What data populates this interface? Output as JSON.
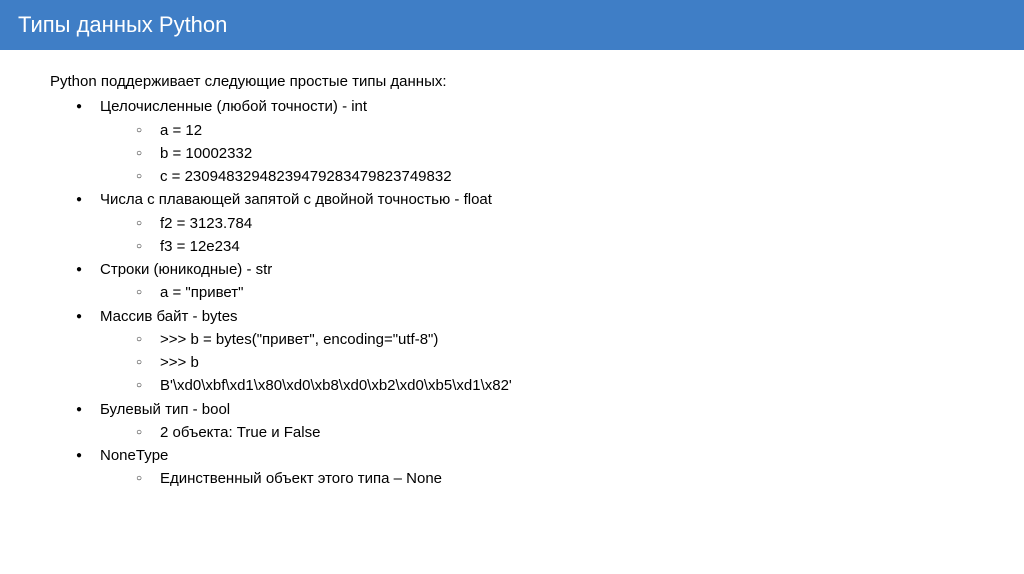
{
  "header": {
    "title": "Типы данных Python"
  },
  "intro": "Python поддерживает следующие простые типы данных:",
  "items": [
    {
      "label": "Целочисленные (любой точности) - int",
      "sub": [
        "a = 12",
        "b = 10002332",
        "c = 23094832948239479283479823749832"
      ]
    },
    {
      "label": "Числа с плавающей запятой с двойной точностью - float",
      "sub": [
        "f2 = 3123.784",
        "f3 = 12e234"
      ]
    },
    {
      "label": "Строки (юникодные) - str",
      "sub": [
        "a = \"привет\""
      ]
    },
    {
      "label": "Массив байт - bytes",
      "sub": [
        ">>> b = bytes(\"привет\", encoding=\"utf-8\")",
        ">>> b",
        "B'\\xd0\\xbf\\xd1\\x80\\xd0\\xb8\\xd0\\xb2\\xd0\\xb5\\xd1\\x82'"
      ]
    },
    {
      "label": "Булевый тип - bool",
      "sub": [
        "2 объекта: True и False"
      ]
    },
    {
      "label": "NoneType",
      "sub": [
        "Единственный объект этого типа – None"
      ]
    }
  ]
}
